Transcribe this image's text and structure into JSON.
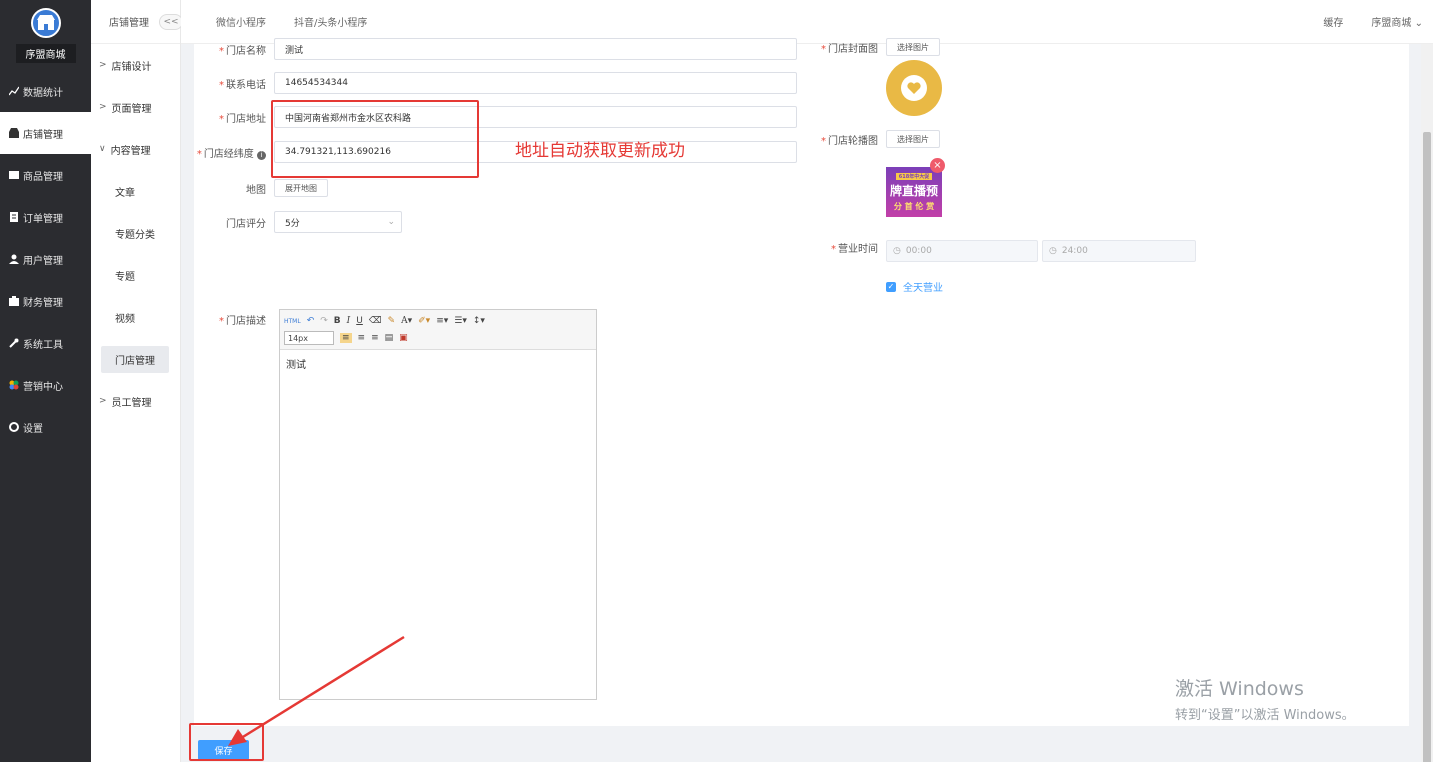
{
  "sidebar": {
    "logo_name": "序盟商城",
    "items": [
      {
        "label": "数据统计",
        "icon": "chart-line-icon"
      },
      {
        "label": "店铺管理",
        "icon": "store-icon"
      },
      {
        "label": "商品管理",
        "icon": "goods-icon"
      },
      {
        "label": "订单管理",
        "icon": "order-icon"
      },
      {
        "label": "用户管理",
        "icon": "user-icon"
      },
      {
        "label": "财务管理",
        "icon": "finance-icon"
      },
      {
        "label": "系统工具",
        "icon": "wrench-icon"
      },
      {
        "label": "营销中心",
        "icon": "marketing-icon"
      },
      {
        "label": "设置",
        "icon": "gear-icon"
      }
    ]
  },
  "subnav": {
    "header": "店铺管理",
    "collapse": "<<",
    "items": [
      "店铺设计",
      "页面管理",
      "内容管理",
      "文章",
      "专题分类",
      "专题",
      "视频",
      "门店管理",
      "员工管理"
    ]
  },
  "topbar": {
    "tabs": [
      "微信小程序",
      "抖音/头条小程序"
    ],
    "cache": "缓存",
    "shop": "序盟商城"
  },
  "form": {
    "name_label": "门店名称",
    "name_value": "测试",
    "phone_label": "联系电话",
    "phone_value": "14654534344",
    "address_label": "门店地址",
    "address_value": "中国河南省郑州市金水区农科路",
    "latlng_label": "门店经纬度",
    "latlng_value": "34.791321,113.690216",
    "map_label": "地图",
    "map_button": "展开地图",
    "rating_label": "门店评分",
    "rating_value": "5分",
    "desc_label": "门店描述",
    "desc_value": "测试",
    "font_size": "14px",
    "cover_label": "门店封面图",
    "carousel_label": "门店轮播图",
    "choose_image": "选择图片",
    "hours_label": "营业时间",
    "open_time": "00:00",
    "close_time": "24:00",
    "all_day": "全天营业",
    "save": "保存"
  },
  "annotation": "地址自动获取更新成功",
  "banner": {
    "top": "618年中大促",
    "main": "牌直播预",
    "sub": "分 首 伦 赏"
  },
  "watermark": {
    "line1": "激活 Windows",
    "line2": "转到“设置”以激活 Windows。"
  },
  "colors": {
    "accent": "#409eff",
    "annotation_red": "#e53935",
    "sidebar_bg": "#2b2c30"
  }
}
